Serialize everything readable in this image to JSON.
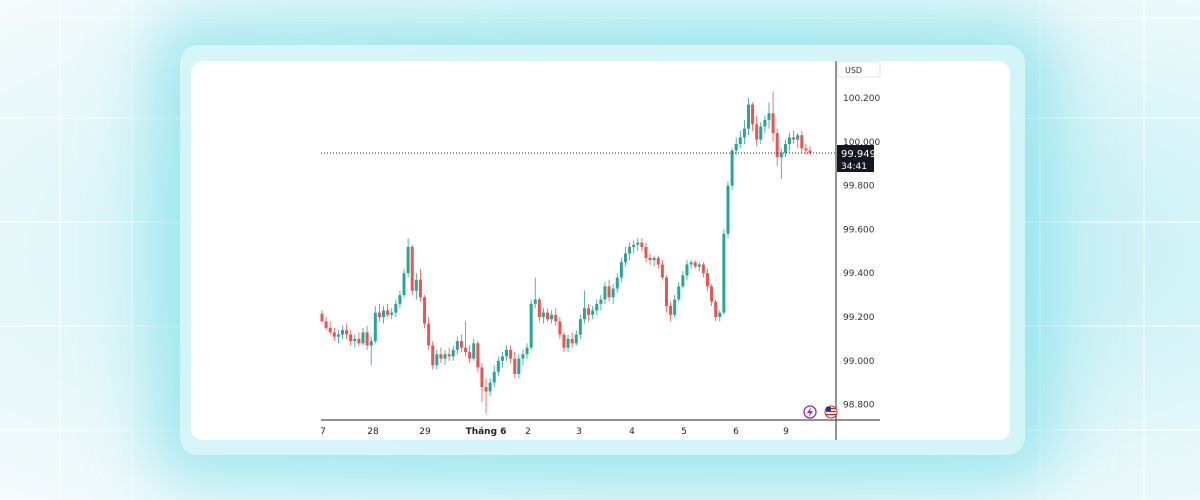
{
  "chart_data": {
    "type": "candlestick",
    "currency": "USD",
    "current_price": "99.949",
    "countdown": "34:41",
    "y_axis": {
      "ticks": [
        "100.200",
        "100.000",
        "99.800",
        "99.600",
        "99.400",
        "99.200",
        "99.000",
        "98.800"
      ],
      "range": [
        98.72,
        100.45
      ]
    },
    "x_axis": {
      "ticks": [
        "7",
        "28",
        "29",
        "Tháng 6",
        "2",
        "3",
        "4",
        "5",
        "6",
        "9"
      ]
    },
    "series": [
      [
        99.215,
        99.23,
        99.175,
        99.18
      ],
      [
        99.18,
        99.2,
        99.14,
        99.15
      ],
      [
        99.15,
        99.18,
        99.12,
        99.13
      ],
      [
        99.13,
        99.15,
        99.09,
        99.11
      ],
      [
        99.11,
        99.14,
        99.08,
        99.12
      ],
      [
        99.12,
        99.16,
        99.1,
        99.14
      ],
      [
        99.14,
        99.17,
        99.1,
        99.12
      ],
      [
        99.12,
        99.14,
        99.07,
        99.09
      ],
      [
        99.09,
        99.12,
        99.06,
        99.1
      ],
      [
        99.1,
        99.13,
        99.07,
        99.08
      ],
      [
        99.08,
        99.15,
        99.07,
        99.13
      ],
      [
        99.13,
        99.16,
        99.05,
        99.07
      ],
      [
        99.07,
        99.11,
        98.98,
        99.09
      ],
      [
        99.09,
        99.25,
        99.08,
        99.22
      ],
      [
        99.22,
        99.26,
        99.18,
        99.2
      ],
      [
        99.2,
        99.25,
        99.17,
        99.23
      ],
      [
        99.23,
        99.26,
        99.2,
        99.21
      ],
      [
        99.21,
        99.24,
        99.19,
        99.22
      ],
      [
        99.22,
        99.28,
        99.2,
        99.26
      ],
      [
        99.26,
        99.32,
        99.24,
        99.3
      ],
      [
        99.3,
        99.42,
        99.29,
        99.4
      ],
      [
        99.4,
        99.56,
        99.38,
        99.52
      ],
      [
        99.52,
        99.53,
        99.3,
        99.32
      ],
      [
        99.32,
        99.4,
        99.28,
        99.37
      ],
      [
        99.37,
        99.42,
        99.27,
        99.29
      ],
      [
        99.29,
        99.3,
        99.15,
        99.17
      ],
      [
        99.17,
        99.2,
        99.05,
        99.07
      ],
      [
        99.07,
        99.09,
        98.96,
        98.98
      ],
      [
        98.98,
        99.05,
        98.96,
        99.03
      ],
      [
        99.03,
        99.06,
        98.99,
        99.01
      ],
      [
        99.01,
        99.05,
        98.98,
        99.03
      ],
      [
        99.03,
        99.06,
        99.0,
        99.02
      ],
      [
        99.02,
        99.07,
        99.0,
        99.05
      ],
      [
        99.05,
        99.11,
        99.03,
        99.09
      ],
      [
        99.09,
        99.12,
        99.04,
        99.06
      ],
      [
        99.06,
        99.18,
        99.02,
        99.04
      ],
      [
        99.04,
        99.07,
        98.99,
        99.01
      ],
      [
        99.01,
        99.1,
        99.0,
        99.08
      ],
      [
        99.08,
        99.09,
        98.95,
        98.97
      ],
      [
        98.97,
        98.99,
        98.81,
        98.88
      ],
      [
        98.88,
        98.92,
        98.76,
        98.86
      ],
      [
        98.86,
        98.92,
        98.84,
        98.9
      ],
      [
        98.9,
        98.98,
        98.88,
        98.95
      ],
      [
        98.95,
        99.02,
        98.93,
        99.0
      ],
      [
        99.0,
        99.04,
        98.97,
        99.02
      ],
      [
        99.02,
        99.07,
        99.0,
        99.05
      ],
      [
        99.05,
        99.07,
        98.99,
        99.01
      ],
      [
        99.01,
        99.04,
        98.92,
        98.94
      ],
      [
        98.94,
        99.03,
        98.92,
        99.01
      ],
      [
        99.01,
        99.05,
        98.98,
        99.03
      ],
      [
        99.03,
        99.08,
        99.01,
        99.06
      ],
      [
        99.06,
        99.28,
        99.05,
        99.26
      ],
      [
        99.26,
        99.38,
        99.24,
        99.28
      ],
      [
        99.28,
        99.29,
        99.18,
        99.2
      ],
      [
        99.2,
        99.24,
        99.17,
        99.22
      ],
      [
        99.22,
        99.24,
        99.18,
        99.19
      ],
      [
        99.19,
        99.23,
        99.17,
        99.21
      ],
      [
        99.21,
        99.24,
        99.16,
        99.18
      ],
      [
        99.18,
        99.2,
        99.1,
        99.12
      ],
      [
        99.12,
        99.13,
        99.04,
        99.06
      ],
      [
        99.06,
        99.12,
        99.04,
        99.1
      ],
      [
        99.1,
        99.13,
        99.06,
        99.08
      ],
      [
        99.08,
        99.14,
        99.07,
        99.12
      ],
      [
        99.12,
        99.21,
        99.1,
        99.19
      ],
      [
        99.19,
        99.32,
        99.17,
        99.24
      ],
      [
        99.24,
        99.26,
        99.18,
        99.21
      ],
      [
        99.21,
        99.25,
        99.19,
        99.23
      ],
      [
        99.23,
        99.28,
        99.21,
        99.26
      ],
      [
        99.26,
        99.3,
        99.23,
        99.28
      ],
      [
        99.28,
        99.36,
        99.26,
        99.34
      ],
      [
        99.34,
        99.37,
        99.27,
        99.29
      ],
      [
        99.29,
        99.35,
        99.26,
        99.33
      ],
      [
        99.33,
        99.4,
        99.31,
        99.38
      ],
      [
        99.38,
        99.47,
        99.36,
        99.45
      ],
      [
        99.45,
        99.52,
        99.43,
        99.49
      ],
      [
        99.49,
        99.54,
        99.46,
        99.52
      ],
      [
        99.52,
        99.55,
        99.49,
        99.53
      ],
      [
        99.53,
        99.56,
        99.5,
        99.54
      ],
      [
        99.54,
        99.56,
        99.5,
        99.52
      ],
      [
        99.52,
        99.54,
        99.45,
        99.47
      ],
      [
        99.47,
        99.49,
        99.44,
        99.46
      ],
      [
        99.46,
        99.48,
        99.43,
        99.47
      ],
      [
        99.47,
        99.48,
        99.42,
        99.44
      ],
      [
        99.44,
        99.46,
        99.37,
        99.38
      ],
      [
        99.38,
        99.39,
        99.22,
        99.25
      ],
      [
        99.25,
        99.27,
        99.18,
        99.21
      ],
      [
        99.21,
        99.3,
        99.2,
        99.28
      ],
      [
        99.28,
        99.36,
        99.27,
        99.34
      ],
      [
        99.34,
        99.41,
        99.33,
        99.39
      ],
      [
        99.39,
        99.46,
        99.37,
        99.44
      ],
      [
        99.44,
        99.46,
        99.42,
        99.45
      ],
      [
        99.45,
        99.46,
        99.42,
        99.43
      ],
      [
        99.43,
        99.45,
        99.41,
        99.44
      ],
      [
        99.44,
        99.45,
        99.38,
        99.4
      ],
      [
        99.4,
        99.42,
        99.32,
        99.34
      ],
      [
        99.34,
        99.35,
        99.25,
        99.27
      ],
      [
        99.27,
        99.28,
        99.18,
        99.2
      ],
      [
        99.2,
        99.23,
        99.18,
        99.22
      ],
      [
        99.22,
        99.6,
        99.21,
        99.58
      ],
      [
        99.58,
        99.82,
        99.56,
        99.8
      ],
      [
        99.8,
        99.97,
        99.78,
        99.96
      ],
      [
        99.96,
        100.02,
        99.94,
        99.99
      ],
      [
        99.99,
        100.05,
        99.97,
        100.02
      ],
      [
        100.02,
        100.1,
        99.99,
        100.06
      ],
      [
        100.06,
        100.2,
        100.03,
        100.17
      ],
      [
        100.17,
        100.18,
        100.05,
        100.08
      ],
      [
        100.08,
        100.12,
        99.98,
        100.01
      ],
      [
        100.01,
        100.09,
        99.99,
        100.07
      ],
      [
        100.07,
        100.12,
        100.04,
        100.1
      ],
      [
        100.1,
        100.18,
        100.06,
        100.13
      ],
      [
        100.13,
        100.23,
        100.0,
        100.04
      ],
      [
        100.04,
        100.06,
        99.89,
        99.93
      ],
      [
        99.93,
        99.97,
        99.83,
        99.95
      ],
      [
        99.95,
        100.01,
        99.93,
        99.99
      ],
      [
        99.99,
        100.04,
        99.96,
        100.02
      ],
      [
        100.02,
        100.05,
        99.99,
        100.01
      ],
      [
        100.01,
        100.04,
        99.97,
        100.03
      ],
      [
        100.03,
        100.05,
        99.95,
        99.97
      ],
      [
        99.97,
        99.99,
        99.94,
        99.96
      ],
      [
        99.96,
        99.98,
        99.94,
        99.949
      ]
    ]
  }
}
